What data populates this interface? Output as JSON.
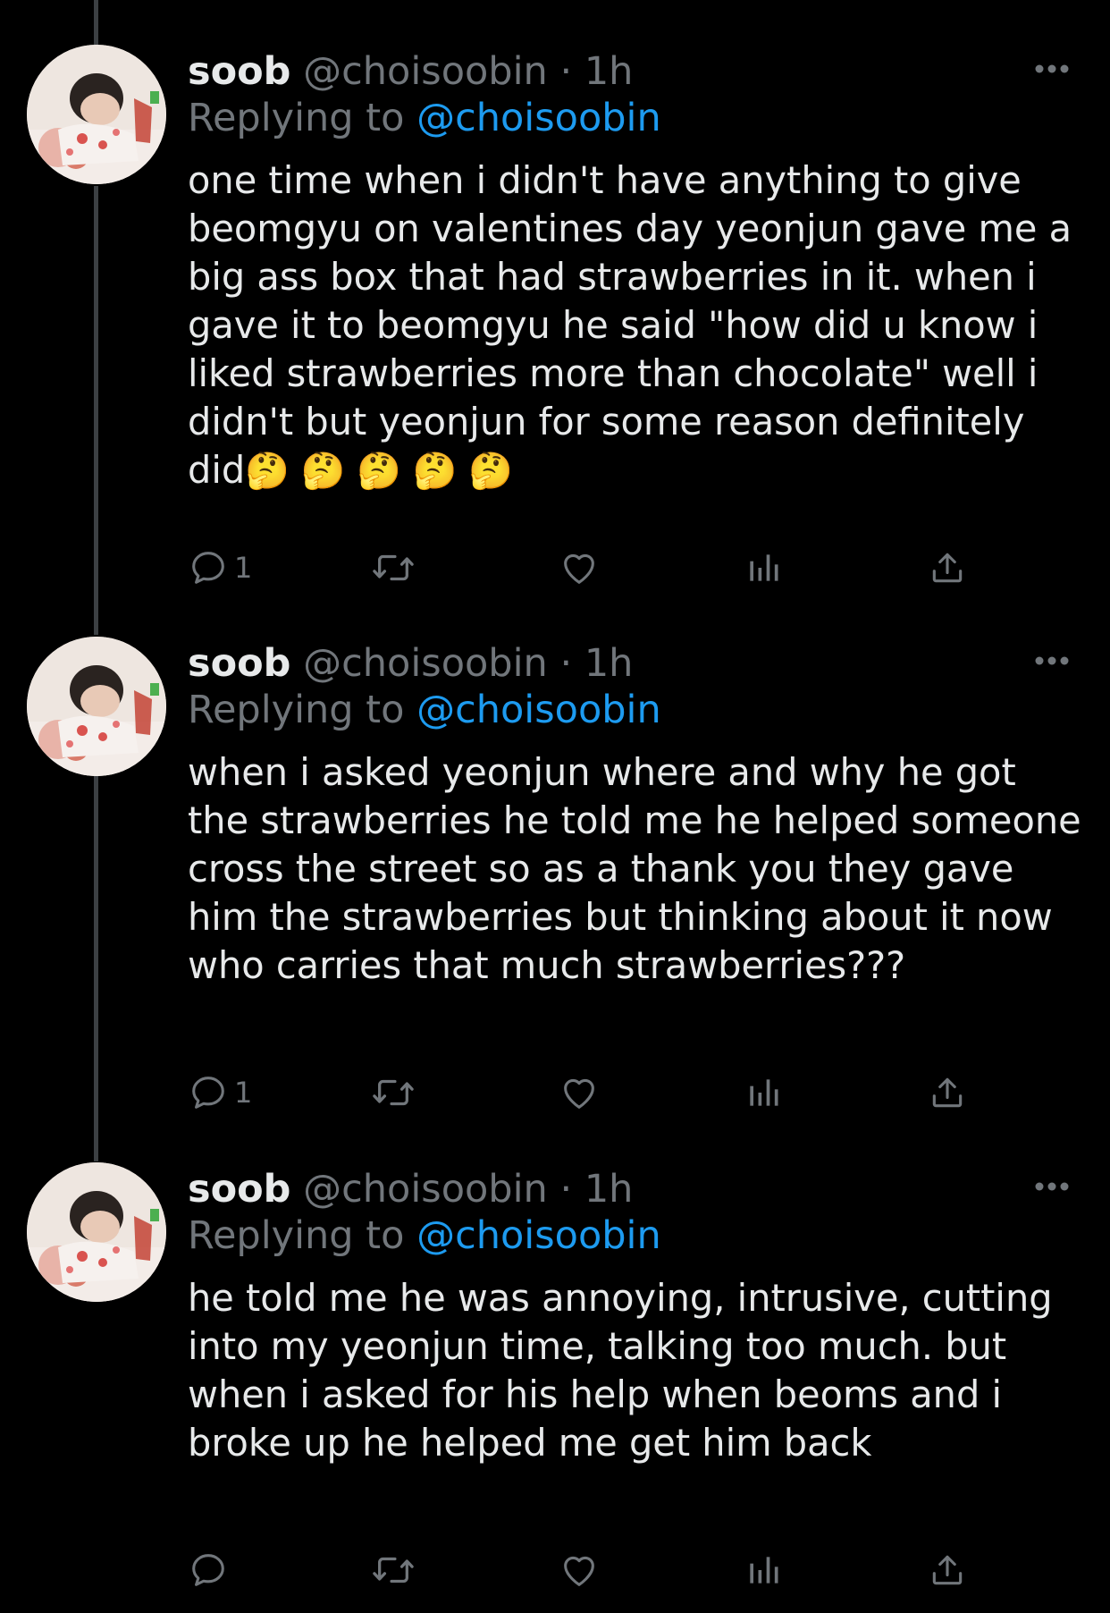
{
  "tweets": [
    {
      "display_name": "soob",
      "handle": "@choisoobin",
      "separator": "·",
      "time": "1h",
      "replying_prefix": "Replying to",
      "replying_to": "@choisoobin",
      "text": "one time when i didn't have anything to give beomgyu on valentines day yeonjun gave me a big ass box that had strawberries in it. when i gave it to beomgyu he said \"how did u know i liked strawberries more than chocolate\" well i didn't but yeonjun for some reason definitely did",
      "emoji": "🤔 🤔 🤔 🤔 🤔",
      "reply_count": "1"
    },
    {
      "display_name": "soob",
      "handle": "@choisoobin",
      "separator": "·",
      "time": "1h",
      "replying_prefix": "Replying to",
      "replying_to": "@choisoobin",
      "text": "when i asked yeonjun where and why he got the strawberries he told me he helped someone cross the street so as a thank you they gave him the strawberries but thinking about it now who carries that much strawberries???",
      "emoji": "",
      "reply_count": "1"
    },
    {
      "display_name": "soob",
      "handle": "@choisoobin",
      "separator": "·",
      "time": "1h",
      "replying_prefix": "Replying to",
      "replying_to": "@choisoobin",
      "text": "he told me he was annoying, intrusive, cutting into my yeonjun time, talking too much. but when i asked for his help when beoms and i broke up he helped me get him back",
      "emoji": "",
      "reply_count": ""
    }
  ],
  "icons": {
    "reply": "speech-bubble-icon",
    "retweet": "retweet-icon",
    "like": "heart-icon",
    "analytics": "bar-chart-icon",
    "share": "share-upload-icon",
    "more": "ellipsis-icon"
  },
  "colors": {
    "background": "#000000",
    "text": "#e7e9ea",
    "secondary": "#71767b",
    "link": "#1d9bf0"
  }
}
